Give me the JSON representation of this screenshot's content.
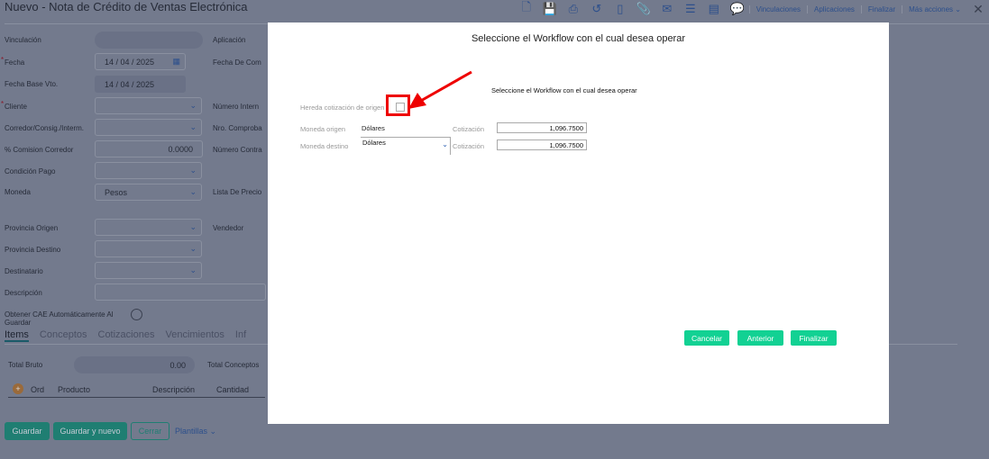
{
  "page": {
    "title": "Nuevo - Nota de Crédito de Ventas Electrónica"
  },
  "toolbar": {
    "links": [
      "Vinculaciones",
      "Aplicaciones",
      "Finalizar",
      "Más acciones"
    ]
  },
  "form": {
    "vinculacion": "Vinculación",
    "aplicacion": "Aplicación",
    "fecha": "Fecha",
    "fecha_value": "14 / 04 / 2025",
    "fecha_comp": "Fecha De Com",
    "fecha_base": "Fecha Base Vto.",
    "fecha_base_value": "14 / 04 / 2025",
    "cliente": "Cliente",
    "numero_interno": "Número Intern",
    "corredor": "Corredor/Consig./Interm.",
    "nro_comprob": "Nro. Comproba",
    "comision": "% Comision Corredor",
    "comision_value": "0.0000",
    "numero_contra": "Número Contra",
    "condicion": "Condición Pago",
    "moneda": "Moneda",
    "moneda_value": "Pesos",
    "lista": "Lista De Precio",
    "prov_origen": "Provincia Origen",
    "vendedor": "Vendedor",
    "prov_destino": "Provincia Destino",
    "destinatario": "Destinatario",
    "descripcion": "Descripción",
    "cae": "Obtener CAE Automáticamente Al Guardar"
  },
  "tabs": [
    "Items",
    "Conceptos",
    "Cotizaciones",
    "Vencimientos",
    "Inf"
  ],
  "totals": {
    "bruto_label": "Total Bruto",
    "bruto_value": "0.00",
    "conceptos_label": "Total Conceptos"
  },
  "grid": {
    "columns": [
      "Ord",
      "Producto",
      "Descripción",
      "Cantidad"
    ]
  },
  "footer": {
    "guardar": "Guardar",
    "guardar_nuevo": "Guardar y nuevo",
    "cerrar": "Cerrar",
    "plantillas": "Plantillas"
  },
  "modal": {
    "title": "Seleccione el Workflow con el cual desea operar",
    "subtitle": "Seleccione el Workflow con el cual desea operar",
    "hereda_label": "Hereda cotización de origen",
    "moneda_origen_label": "Moneda origen",
    "moneda_origen_value": "Dólares",
    "moneda_destino_label": "Moneda destino",
    "moneda_destino_value": "Dólares",
    "cotizacion_label": "Cotización",
    "cotizacion_origen": "1,096.7500",
    "cotizacion_destino": "1,096.7500",
    "cancelar": "Cancelar",
    "anterior": "Anterior",
    "finalizar": "Finalizar"
  },
  "colors": {
    "accent": "#12d193",
    "highlight": "#ee0000"
  }
}
